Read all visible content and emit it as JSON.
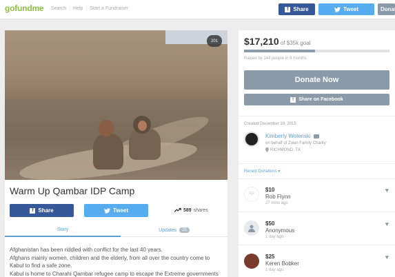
{
  "header": {
    "logo": "gofundme",
    "nav": [
      "Search",
      "Help",
      "Start a Fundraiser"
    ],
    "share_label": "Share",
    "tweet_label": "Tweet",
    "donate_label": "Donate"
  },
  "campaign": {
    "title": "Warm Up Qambar IDP Camp",
    "share_label": "Share",
    "tweet_label": "Tweet",
    "shares_count": "589",
    "shares_label": "shares",
    "tabs": {
      "story": "Story",
      "updates": "Updates",
      "updates_count": "25"
    },
    "story_lines": [
      "Afghanistan has been riddled with conflict for the last 40 years.",
      "Afghans mainly women, children and the elderly, from all over the country come to Kabul to find a safe zone.",
      "Kabul is home to Charahi Qambar refugee camp to escape the Extreme governments and"
    ],
    "photo_likes": "201"
  },
  "funding": {
    "raised": "$17,210",
    "goal_text": "of $35k goal",
    "progress_fraction": 0.49,
    "meta": "Raised by 144 people in 8 months",
    "donate_label": "Donate Now",
    "fb_label": "Share on Facebook"
  },
  "organizer": {
    "created": "Created December 19, 2015",
    "name": "Kimberly Wolenski",
    "on_behalf": "on behalf of Zwan Family Charity",
    "location": "RICHMOND, TX",
    "recent_label": "Recent Donations"
  },
  "donations": [
    {
      "amount": "$10",
      "name": "Rob Flynn",
      "time": "27 mins ago",
      "avatar_text": "RF"
    },
    {
      "amount": "$50",
      "name": "Anonymous",
      "time": "1 day ago",
      "avatar_text": ""
    },
    {
      "amount": "$25",
      "name": "Keren Bobker",
      "time": "1 day ago",
      "avatar_text": ""
    }
  ]
}
